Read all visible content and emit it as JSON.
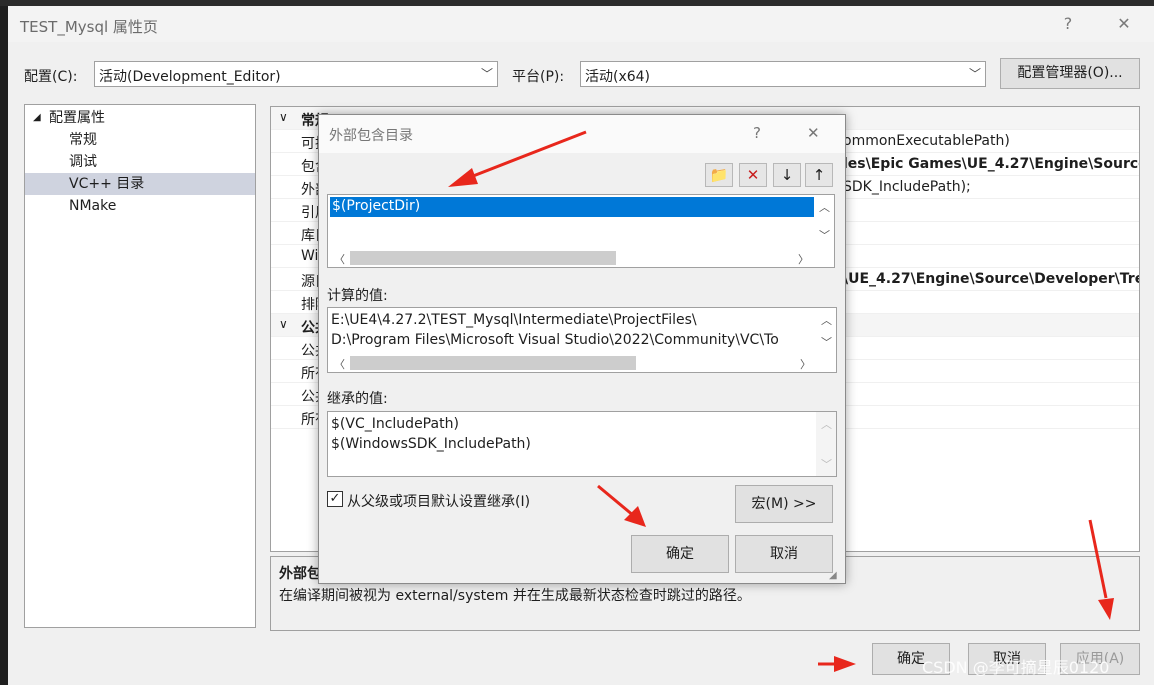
{
  "window": {
    "title": "TEST_Mysql 属性页",
    "help_glyph": "?",
    "close_glyph": "✕"
  },
  "config": {
    "config_label": "配置(C):",
    "config_value": "活动(Development_Editor)",
    "platform_label": "平台(P):",
    "platform_value": "活动(x64)",
    "manager_button": "配置管理器(O)..."
  },
  "tree": {
    "root": "配置属性",
    "items": [
      "常规",
      "调试",
      "VC++ 目录",
      "NMake"
    ],
    "selected": "VC++ 目录"
  },
  "grid": {
    "cat1": "常规",
    "rows1": [
      {
        "k": "可执",
        "v": "ommonExecutablePath)",
        "bold": false
      },
      {
        "k": "包含",
        "v": "les\\Epic Games\\UE_4.27\\Engine\\Source",
        "bold": true
      },
      {
        "k": "外部",
        "v": "SDK_IncludePath);",
        "bold": false
      },
      {
        "k": "引用",
        "v": "",
        "bold": false
      },
      {
        "k": "库目",
        "v": "",
        "bold": false
      },
      {
        "k": "Wi",
        "v": "",
        "bold": false
      },
      {
        "k": "源目",
        "v": "\\UE_4.27\\Engine\\Source\\Developer\\Tre",
        "bold": true
      },
      {
        "k": "排除",
        "v": "",
        "bold": false
      }
    ],
    "cat2": "公共",
    "rows2": [
      {
        "k": "公共",
        "v": ""
      },
      {
        "k": "所有",
        "v": ""
      },
      {
        "k": "公共",
        "v": ""
      },
      {
        "k": "所有",
        "v": ""
      }
    ]
  },
  "description": {
    "title": "外部包",
    "text": "在编译期间被视为 external/system 并在生成最新状态检查时跳过的路径。"
  },
  "bottom": {
    "ok": "确定",
    "cancel": "取消",
    "apply": "应用(A)"
  },
  "dialog": {
    "title": "外部包含目录",
    "help_glyph": "?",
    "close_glyph": "✕",
    "entries": [
      "$(ProjectDir)"
    ],
    "computed_label": "计算的值:",
    "computed_lines": [
      "E:\\UE4\\4.27.2\\TEST_Mysql\\Intermediate\\ProjectFiles\\",
      "D:\\Program Files\\Microsoft Visual Studio\\2022\\Community\\VC\\To"
    ],
    "inherited_label": "继承的值:",
    "inherited_lines": [
      "$(VC_IncludePath)",
      "$(WindowsSDK_IncludePath)"
    ],
    "inherit_checkbox": "从父级或项目默认设置继承(I)",
    "inherit_checked": true,
    "macro_button": "宏(M) >>",
    "ok": "确定",
    "cancel": "取消"
  },
  "watermark": "CSDN @李可摘星辰0120",
  "colors": {
    "selection": "#0078d7",
    "tree_selection": "#cfd3df",
    "annotation_arrow": "#e8271c"
  }
}
